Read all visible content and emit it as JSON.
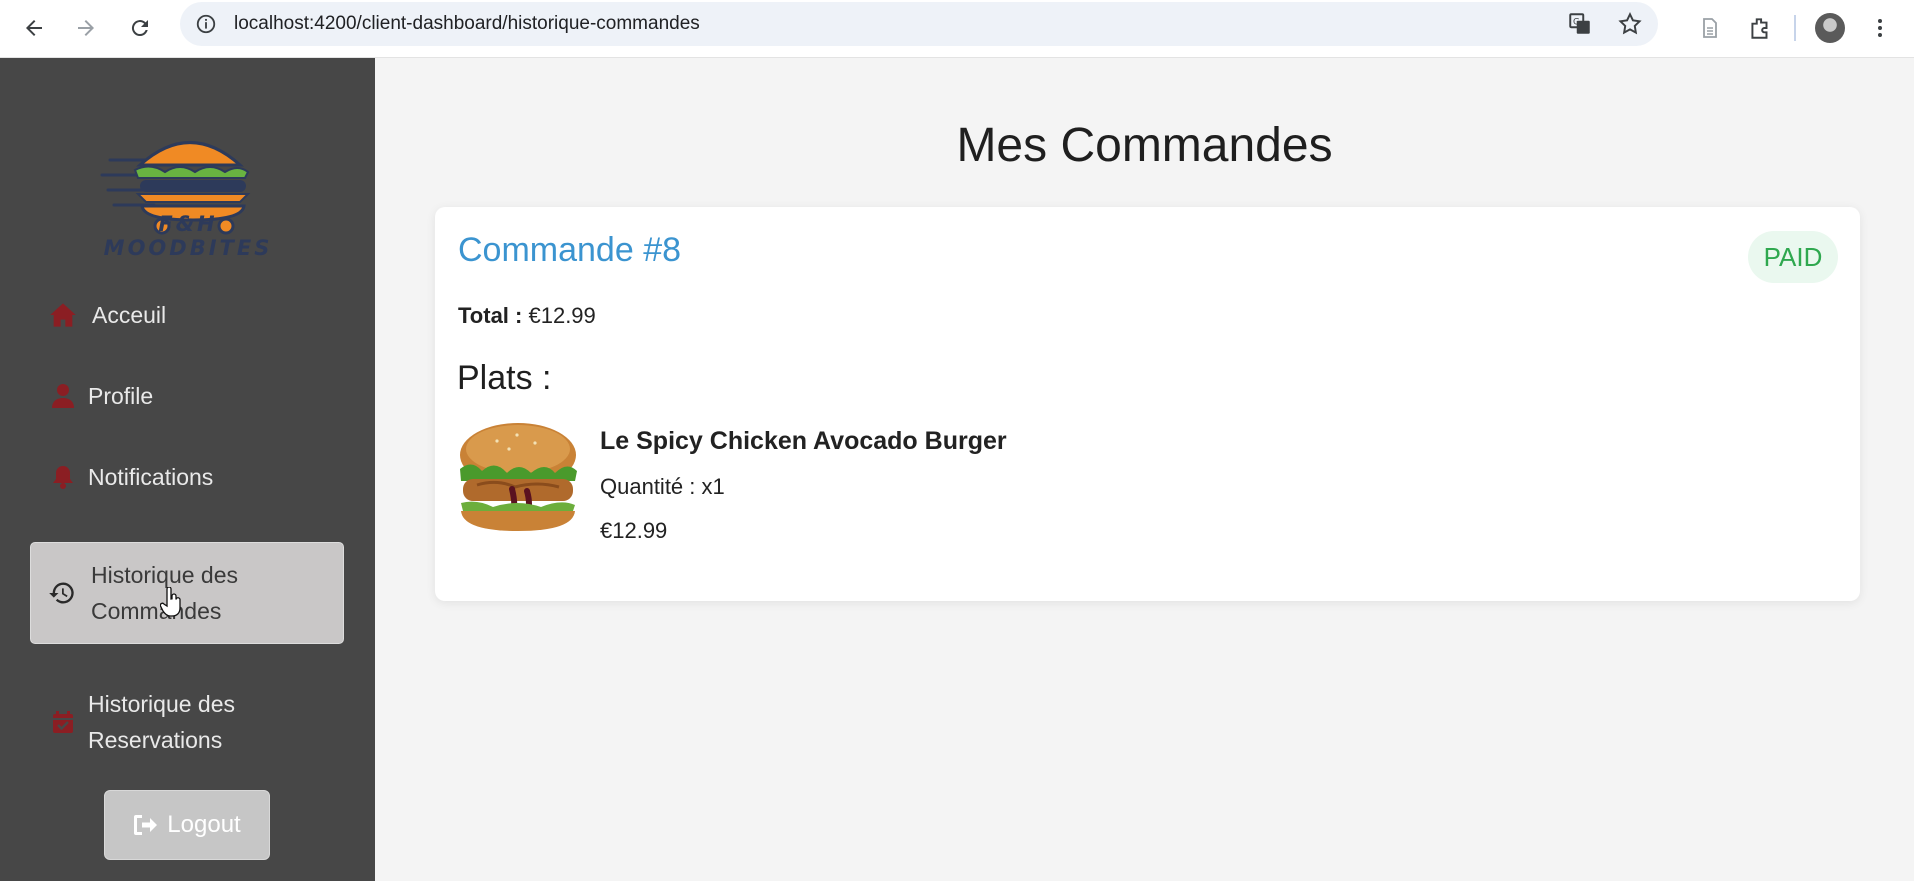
{
  "browser": {
    "url": "localhost:4200/client-dashboard/historique-commandes"
  },
  "sidebar": {
    "logo_text": "F&H MOODBITES",
    "items": [
      {
        "label": "Acceuil",
        "icon": "home-icon"
      },
      {
        "label": "Profile",
        "icon": "user-icon"
      },
      {
        "label": "Notifications",
        "icon": "bell-icon"
      },
      {
        "label": "Historique des Commandes",
        "icon": "history-icon",
        "active": true
      },
      {
        "label": "Historique des Reservations",
        "icon": "calendar-check-icon"
      }
    ],
    "logout_label": "Logout"
  },
  "main": {
    "title": "Mes Commandes",
    "order": {
      "title": "Commande #8",
      "status": "PAID",
      "total_label": "Total :",
      "total_value": "€12.99",
      "plats_label": "Plats :",
      "dishes": [
        {
          "name": "Le Spicy Chicken Avocado Burger",
          "quantity": "Quantité : x1",
          "price": "€12.99"
        }
      ]
    }
  },
  "colors": {
    "sidebar_bg": "#474747",
    "accent_blue": "#3b94d0",
    "paid_green": "#2fa84f",
    "active_item_bg": "#c9c7c7"
  }
}
